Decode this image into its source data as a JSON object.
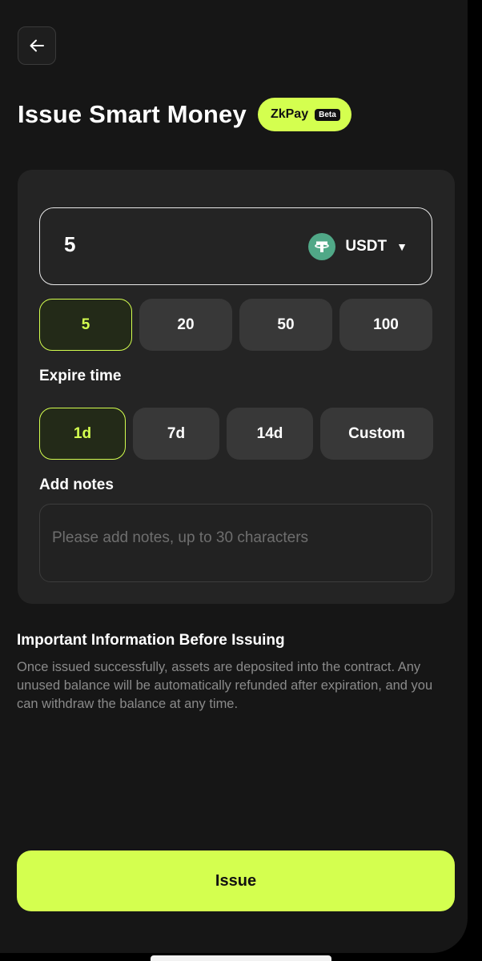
{
  "header": {
    "back_icon": "arrow-left-icon",
    "title": "Issue Smart Money",
    "brand": "ZkPay",
    "beta_badge": "Beta"
  },
  "amount": {
    "value": "5",
    "currency": "USDT",
    "currency_icon": "tether-icon",
    "dropdown_icon": "caret-down-icon",
    "presets": [
      "5",
      "20",
      "50",
      "100"
    ],
    "selected_preset": "5"
  },
  "expire": {
    "label": "Expire time",
    "options": [
      "1d",
      "7d",
      "14d",
      "Custom"
    ],
    "selected": "1d"
  },
  "notes": {
    "label": "Add notes",
    "placeholder": "Please add notes, up to 30 characters",
    "value": ""
  },
  "info": {
    "title": "Important Information Before Issuing",
    "body": "Once issued successfully, assets are deposited into the contract. Any unused balance will be automatically refunded after expiration, and you can withdraw the balance at any time."
  },
  "actions": {
    "issue_label": "Issue"
  },
  "colors": {
    "accent": "#d4ff4f",
    "background": "#161616",
    "card": "#242424",
    "chip": "#383838",
    "tether_green": "#50a887"
  }
}
